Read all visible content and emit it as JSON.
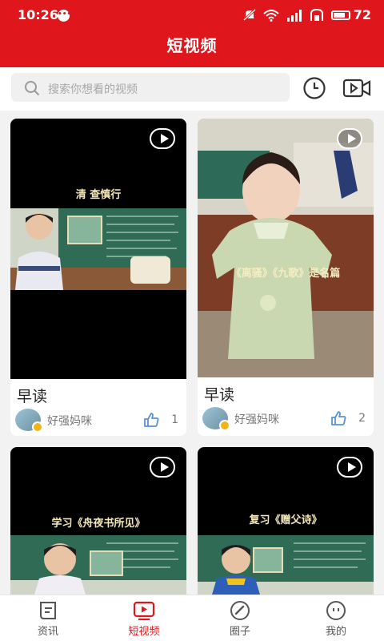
{
  "status": {
    "time": "10:26",
    "msg_badge": "•••",
    "battery": "72"
  },
  "header": {
    "title": "短视频"
  },
  "search": {
    "placeholder": "搜索你想看的视频"
  },
  "colors": {
    "brand": "#e0161d",
    "like": "#5b8fd6"
  },
  "cards": [
    {
      "caption": "清 查慎行",
      "title": "早读",
      "author": "好强妈咪",
      "likes": "1"
    },
    {
      "caption": "《离骚》《九歌》是名篇",
      "title": "早读",
      "author": "好强妈咪",
      "likes": "2"
    },
    {
      "caption": "学习《舟夜书所见》"
    },
    {
      "caption": "复习《赠父诗》"
    }
  ],
  "tabs": [
    {
      "label": "资讯",
      "icon": "news-icon"
    },
    {
      "label": "短视频",
      "icon": "video-play-icon"
    },
    {
      "label": "圈子",
      "icon": "circle-icon"
    },
    {
      "label": "我的",
      "icon": "profile-icon"
    }
  ],
  "active_tab": "短视频"
}
